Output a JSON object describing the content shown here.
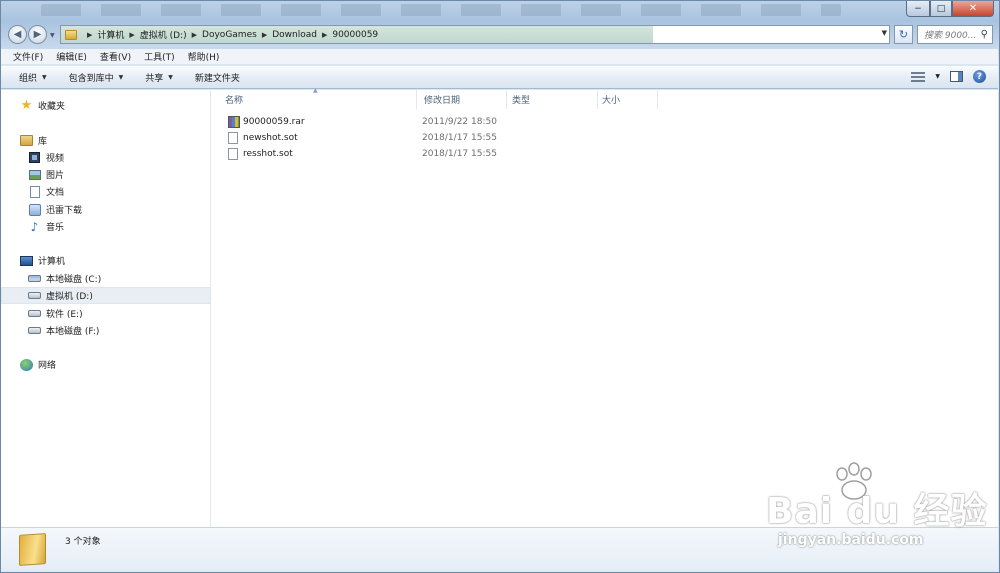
{
  "window": {
    "minimize": "−",
    "maximize": "□",
    "close": "✕"
  },
  "address": {
    "crumbs": [
      "计算机",
      "虚拟机 (D:)",
      "DoyoGames",
      "Download",
      "90000059"
    ],
    "search_placeholder": "搜索 9000..."
  },
  "menu": [
    "文件(F)",
    "编辑(E)",
    "查看(V)",
    "工具(T)",
    "帮助(H)"
  ],
  "commands": [
    "组织",
    "包含到库中",
    "共享",
    "新建文件夹"
  ],
  "sidebar": {
    "favorites": "收藏夹",
    "libraries": "库",
    "library_items": [
      "视频",
      "图片",
      "文档",
      "迅雷下载",
      "音乐"
    ],
    "computer": "计算机",
    "drives": [
      "本地磁盘 (C:)",
      "虚拟机 (D:)",
      "软件 (E:)",
      "本地磁盘 (F:)"
    ],
    "selected_drive": "虚拟机 (D:)",
    "network": "网络"
  },
  "columns": [
    "名称",
    "修改日期",
    "类型",
    "大小"
  ],
  "files": [
    {
      "name": "90000059.rar",
      "date": "2011/9/22 18:50",
      "icon": "rar-archive-icon"
    },
    {
      "name": "newshot.sot",
      "date": "2018/1/17 15:55",
      "icon": "blank-file-icon"
    },
    {
      "name": "resshot.sot",
      "date": "2018/1/17 15:55",
      "icon": "blank-file-icon"
    }
  ],
  "status": {
    "count": "3 个对象"
  },
  "watermark": {
    "brand": "Bai du 经验",
    "url": "jingyan.baidu.com"
  }
}
